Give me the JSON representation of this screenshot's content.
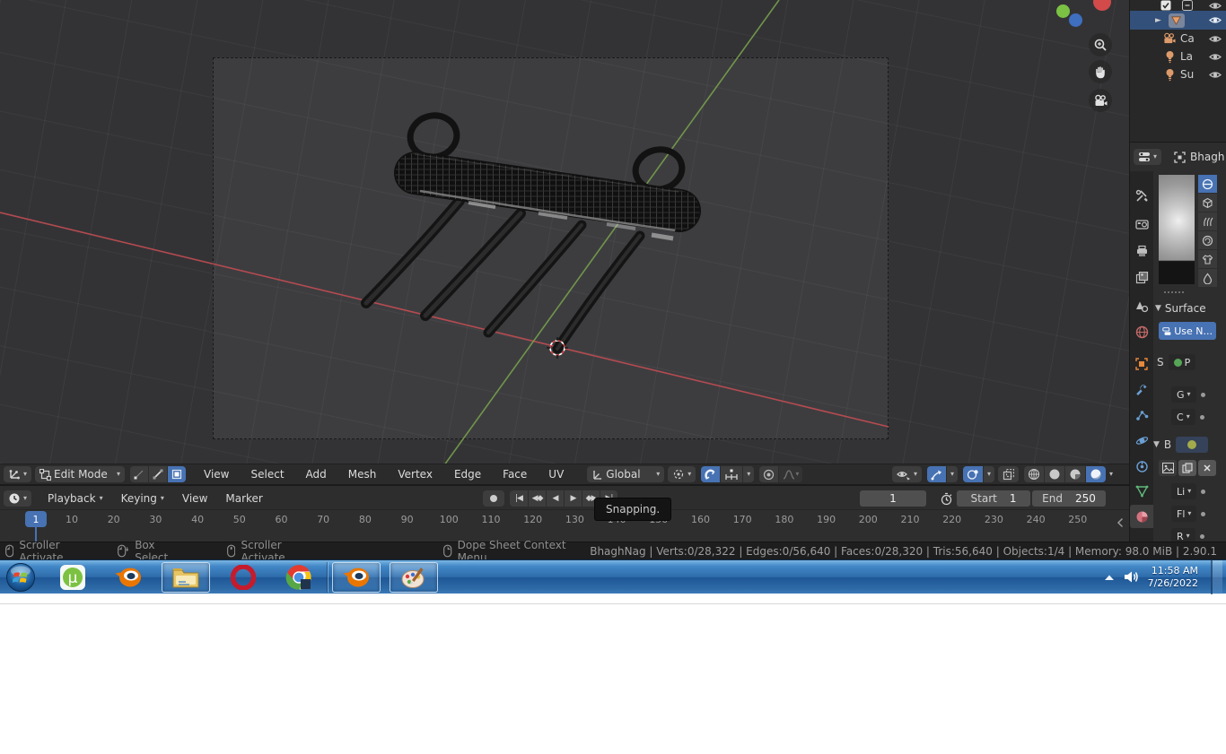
{
  "viewport": {
    "header": {
      "mode": "Edit Mode",
      "menus": [
        "View",
        "Select",
        "Add",
        "Mesh",
        "Vertex",
        "Edge",
        "Face",
        "UV"
      ],
      "orientation": "Global"
    }
  },
  "timeline": {
    "menus": {
      "playback": "Playback",
      "keying": "Keying",
      "view": "View",
      "marker": "Marker"
    },
    "playhead": "1",
    "current_frame": "1",
    "start_label": "Start",
    "start_value": "1",
    "end_label": "End",
    "end_value": "250",
    "ticks": [
      "10",
      "20",
      "30",
      "40",
      "50",
      "60",
      "70",
      "80",
      "90",
      "100",
      "110",
      "120",
      "130",
      "140",
      "150",
      "160",
      "170",
      "180",
      "190",
      "200",
      "210",
      "220",
      "230",
      "240",
      "250"
    ]
  },
  "tooltip": {
    "text": "Snapping."
  },
  "statusbar": {
    "hints": [
      "Scroller Activate",
      "Box Select",
      "Scroller Activate",
      "Dope Sheet Context Menu"
    ],
    "stats": "BhaghNag | Verts:0/28,322 | Edges:0/56,640 | Faces:0/28,320 | Tris:56,640 | Objects:1/4 | Memory: 98.0 MiB | 2.90.1"
  },
  "outliner": {
    "items": [
      {
        "label": "Ca"
      },
      {
        "label": "La"
      },
      {
        "label": "Su"
      }
    ]
  },
  "properties": {
    "object_name": "Bhagh",
    "surface_panel_title": "Surface",
    "use_nodes_label": "Use N...",
    "row_s": "S",
    "row_p": "P",
    "row_g": "G",
    "row_c": "C",
    "row_b": "B",
    "row_li": "Li",
    "row_fl": "Fl",
    "row_r": "R"
  },
  "taskbar": {
    "time": "11:58 AM",
    "date": "7/26/2022"
  },
  "colors": {
    "accent_blue": "#4772b3",
    "selection_blue": "#33507a",
    "axis_red": "#c24d52",
    "axis_green": "#77a04c",
    "taskbar_blue": "#2f6cab"
  }
}
